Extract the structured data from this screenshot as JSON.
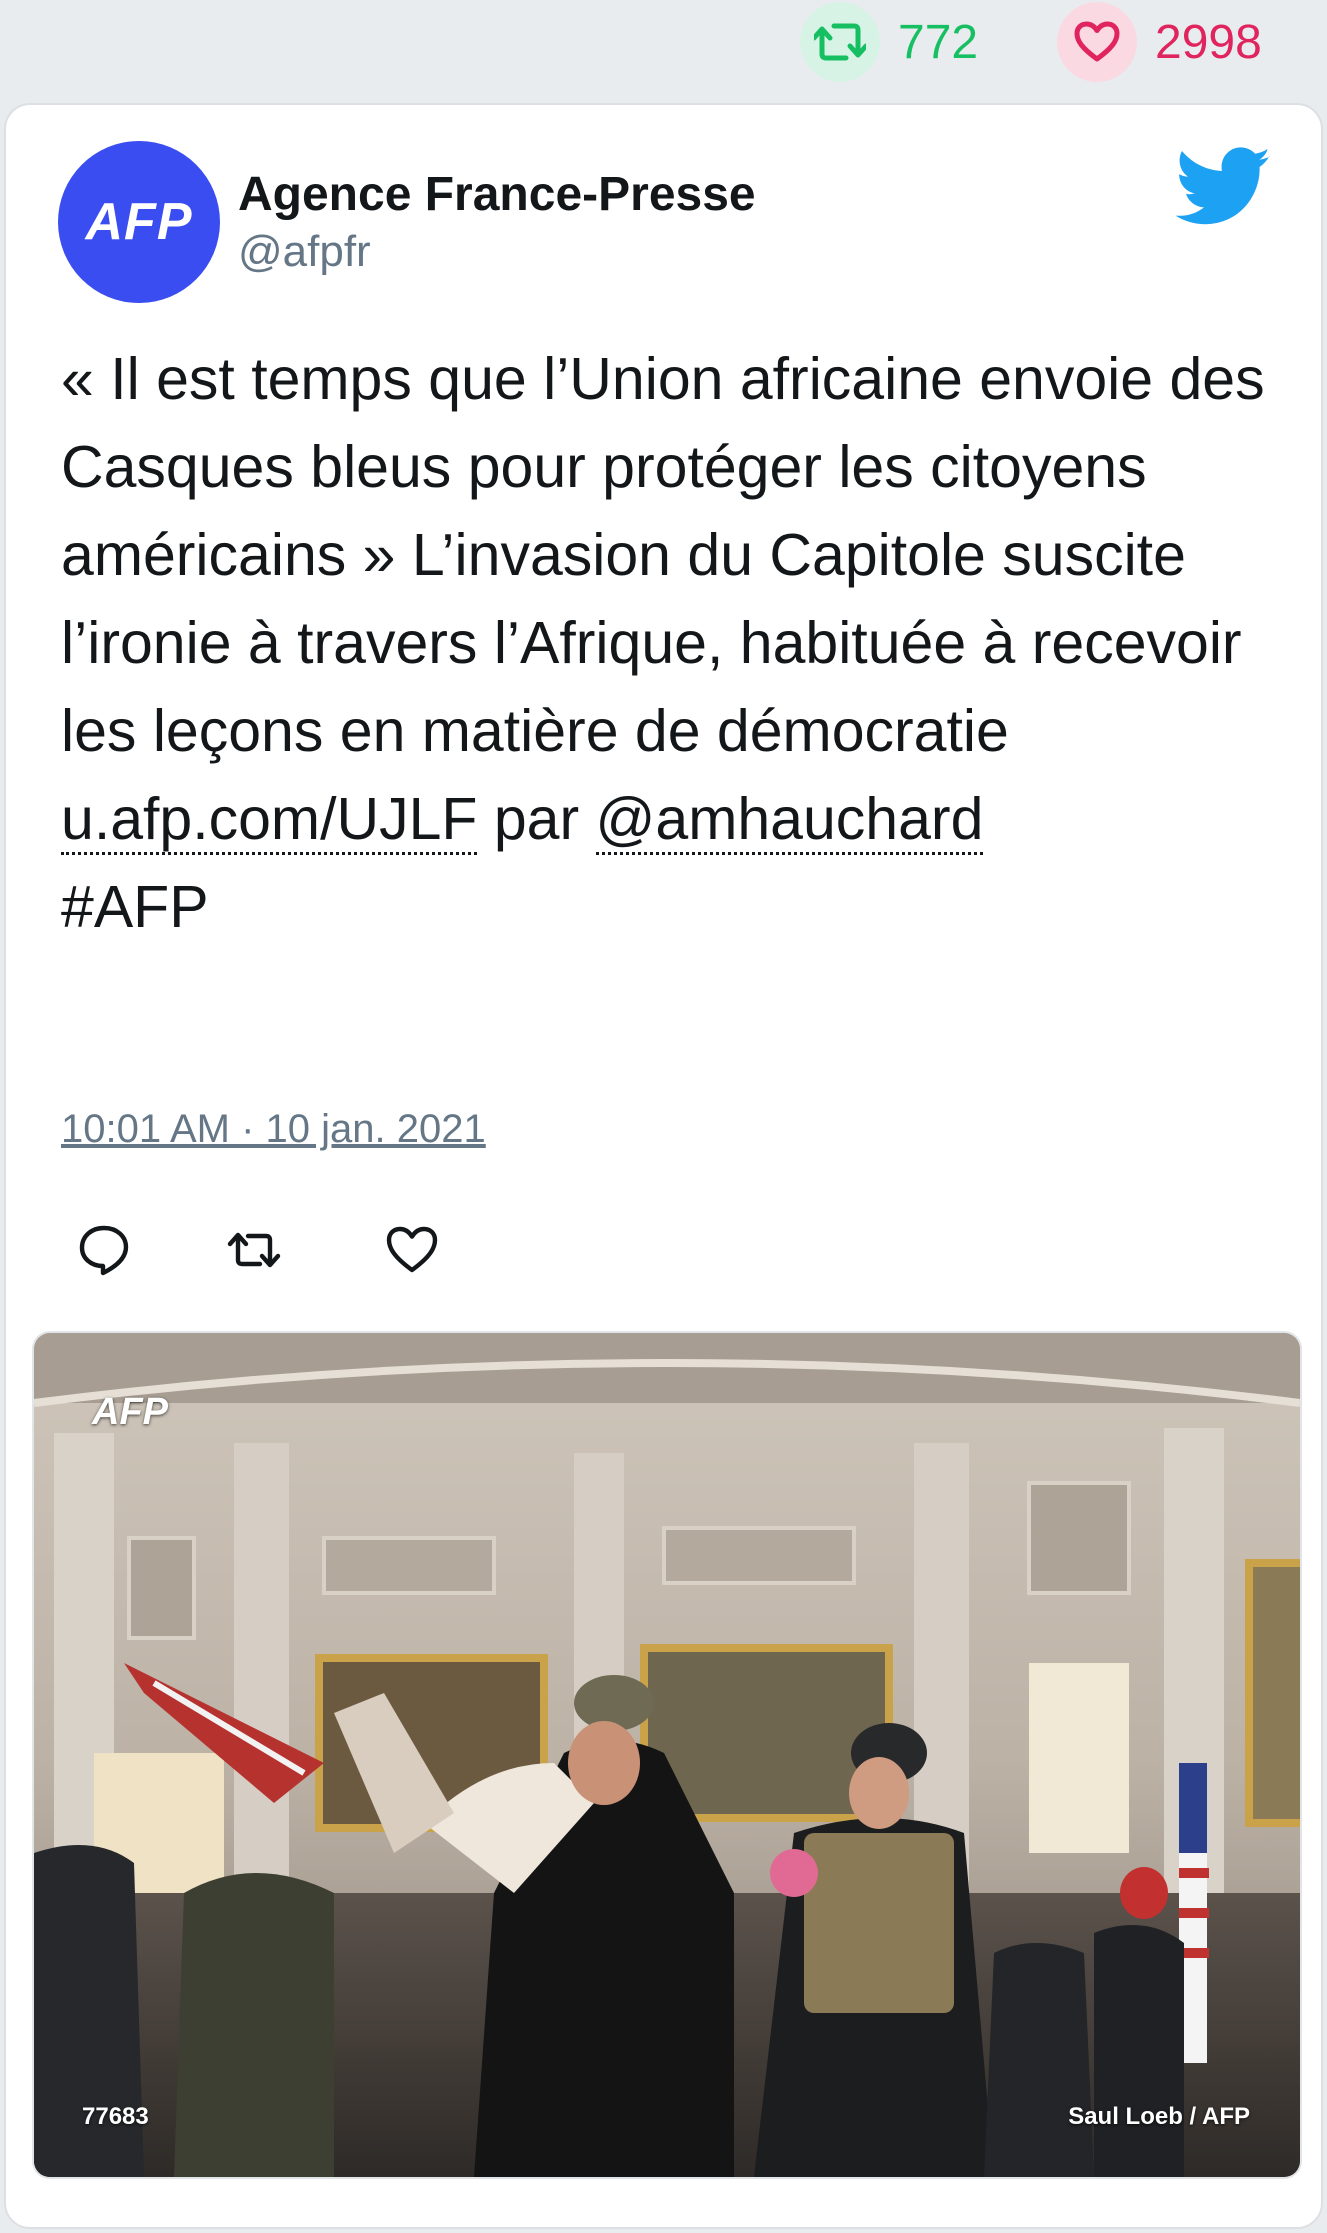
{
  "stats": {
    "retweets": "772",
    "likes": "2998"
  },
  "author": {
    "avatar_text": "AFP",
    "name": "Agence France-Presse",
    "handle": "@afpfr"
  },
  "tweet": {
    "text_before": "« Il est temps que l’Union africaine envoie des Casques bleus pour protéger les citoyens américains » L’invasion du Capitole suscite l’ironie à travers l’Afrique, habituée à recevoir les leçons en matière de démocratie ",
    "link": "u.afp.com/UJLF",
    "middle": " par ",
    "mention": "@amhauchard",
    "hashtag": "#AFP",
    "timestamp": "10:01 AM · 10 jan. 2021"
  },
  "photo": {
    "watermark": "AFP",
    "id": "77683",
    "credit": "Saul Loeb / AFP"
  },
  "icons": {
    "retweet_stat": "retweet-icon",
    "like_stat": "heart-icon",
    "brand": "twitter-bird-icon",
    "reply": "reply-icon",
    "retweet": "retweet-icon",
    "like": "heart-icon"
  },
  "colors": {
    "retweet": "#17bf63",
    "like": "#e0245e",
    "avatar": "#3a4df0",
    "twitter": "#1da1f2"
  }
}
